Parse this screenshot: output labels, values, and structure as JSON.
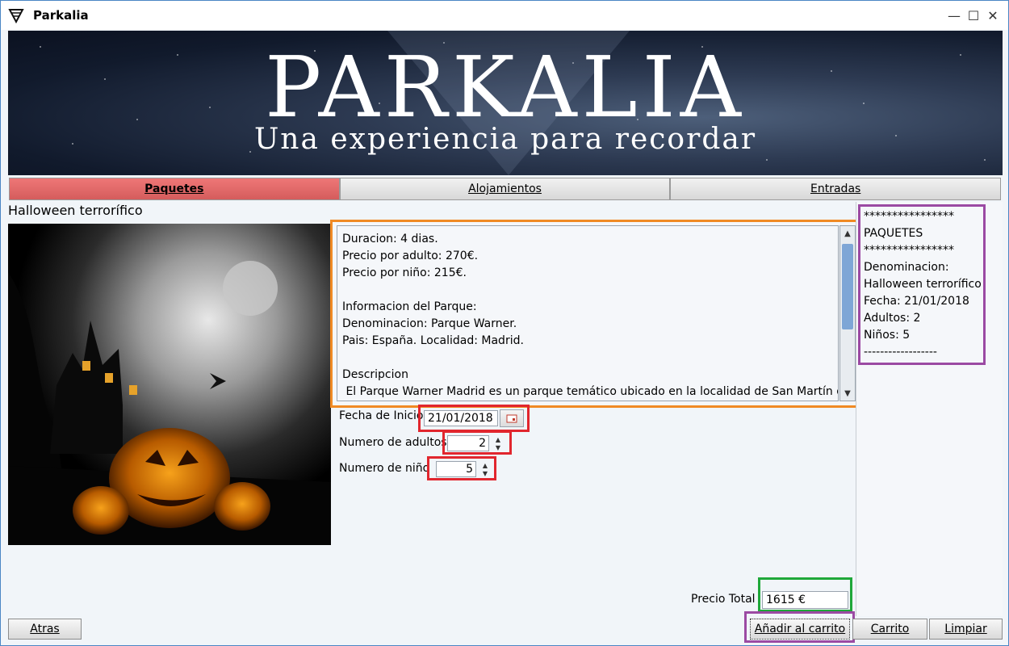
{
  "window": {
    "title": "Parkalia"
  },
  "banner": {
    "brand": "PARKALIA",
    "tagline": "Una experiencia para recordar"
  },
  "tabs": [
    {
      "label": "Paquetes",
      "active": true
    },
    {
      "label": "Alojamientos",
      "active": false
    },
    {
      "label": "Entradas",
      "active": false
    }
  ],
  "package": {
    "title": "Halloween terrorífico",
    "details": "Duracion: 4 dias.\nPrecio por adulto: 270€.\nPrecio por niño: 215€.\n\nInformacion del Parque:\nDenominacion: Parque Warner.\nPais: España. Localidad: Madrid.\n\nDescripcion\n El Parque Warner Madrid es un parque temático ubicado en la localidad de San Martín de"
  },
  "form": {
    "start_date_label": "Fecha de Inicio",
    "start_date_value": "21/01/2018",
    "adults_label": "Numero de adultos",
    "adults_value": "2",
    "children_label": "Numero de niño",
    "children_value": "5"
  },
  "cart": {
    "summary": "****************\nPAQUETES\n****************\nDenominacion:\nHalloween terrorífico\nFecha: 21/01/2018\nAdultos: 2\nNiños: 5\n------------------"
  },
  "total": {
    "label": "Precio Total",
    "value": "1615 €"
  },
  "buttons": {
    "back": "Atras",
    "add_to_cart": "Añadir al carrito",
    "cart": "Carrito",
    "clear": "Limpiar"
  },
  "colors": {
    "active_tab": "#e06666",
    "highlight_orange": "#f08a24",
    "highlight_red": "#e1262e",
    "highlight_green": "#1fa83a",
    "highlight_purple": "#9b4aa3"
  }
}
